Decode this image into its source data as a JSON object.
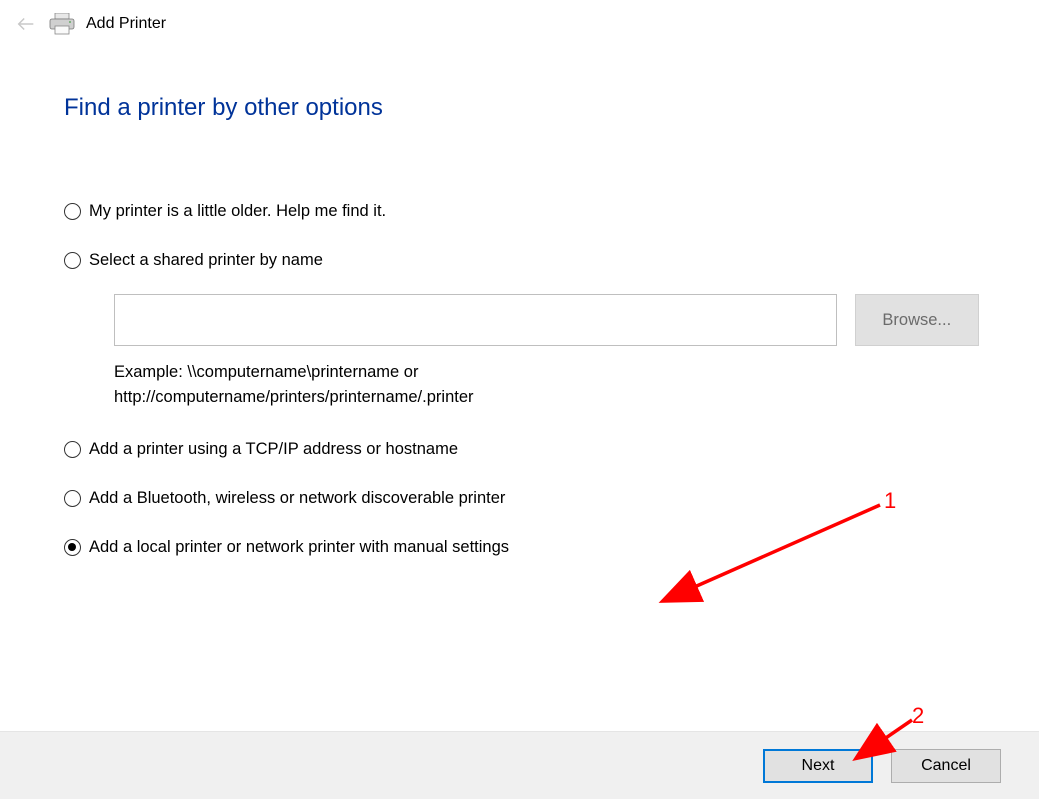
{
  "titlebar": {
    "title": "Add Printer"
  },
  "page": {
    "heading": "Find a printer by other options"
  },
  "options": {
    "older": "My printer is a little older. Help me find it.",
    "shared": "Select a shared printer by name",
    "shared_input_value": "",
    "browse_label": "Browse...",
    "example_line1": "Example: \\\\computername\\printername or",
    "example_line2": "http://computername/printers/printername/.printer",
    "tcpip": "Add a printer using a TCP/IP address or hostname",
    "bluetooth": "Add a Bluetooth, wireless or network discoverable printer",
    "local": "Add a local printer or network printer with manual settings"
  },
  "footer": {
    "next": "Next",
    "cancel": "Cancel"
  },
  "annotations": {
    "label1": "1",
    "label2": "2"
  }
}
